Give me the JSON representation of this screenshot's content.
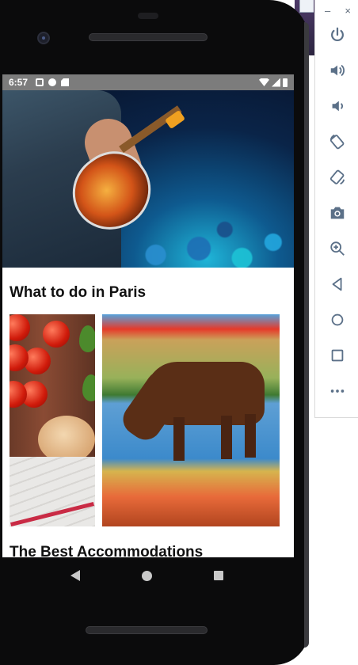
{
  "status_bar": {
    "time": "6:57",
    "icons": [
      "a-badge-icon",
      "f-badge-icon",
      "sd-card-icon",
      "wifi-icon",
      "signal-icon",
      "battery-icon"
    ]
  },
  "content": {
    "section_title": "What to do in Paris",
    "next_section_title": "The Best Accommodations"
  },
  "side_panel": {
    "minimize_label": "–",
    "close_label": "×",
    "tools": [
      "power-icon",
      "volume-up-icon",
      "volume-down-icon",
      "rotate-left-icon",
      "rotate-right-icon",
      "screenshot-icon",
      "zoom-icon",
      "back-icon",
      "home-icon",
      "overview-icon",
      "more-icon"
    ]
  },
  "colors": {
    "status_bar": "#7c7c7c",
    "panel_icon": "#5b7088",
    "phone_body": "#0b0b0c"
  }
}
